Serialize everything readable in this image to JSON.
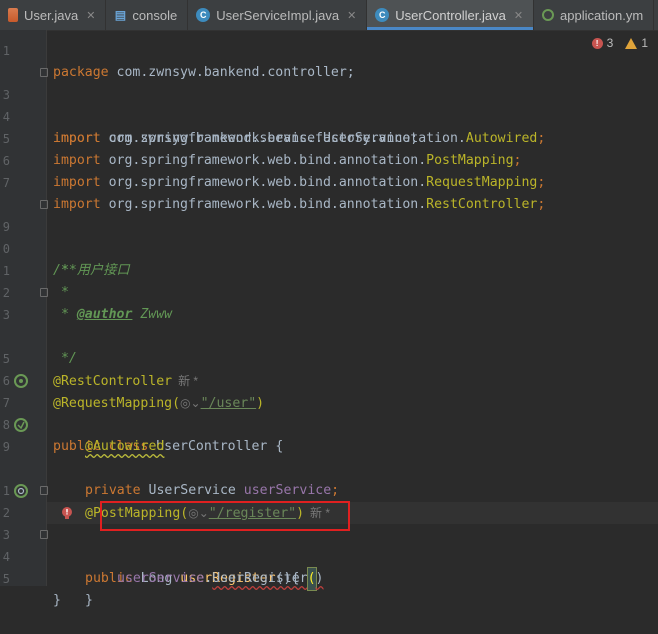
{
  "tabs": [
    {
      "label": "User.java",
      "icon": "java-class-icon",
      "active": false
    },
    {
      "label": "console",
      "icon": "console-icon",
      "active": false
    },
    {
      "label": "UserServiceImpl.java",
      "icon": "java-class-icon",
      "active": false
    },
    {
      "label": "UserController.java",
      "icon": "java-class-icon",
      "active": true
    },
    {
      "label": "application.ym",
      "icon": "spring-config-icon",
      "active": false
    }
  ],
  "inspection": {
    "errors": "3",
    "warnings": "1"
  },
  "gutter_line_numbers": [
    "1",
    "",
    "3",
    "4",
    "5",
    "6",
    "7",
    "",
    "9",
    "0",
    "1",
    "2",
    "3",
    "4",
    "5",
    "6",
    "7",
    "8",
    "9",
    "0",
    "1",
    "2",
    "3",
    "4",
    "5"
  ],
  "code": {
    "l1_kw": "package",
    "l1_rest": " com.zwnsyw.bankend.controller;",
    "imp": "import",
    "l3": " com.zwnsyw.bankend.service.UserService;",
    "l4_pkg": " org.springframework.beans.factory.annotation.",
    "l4_cls": "Autowired",
    "l5_pkg": " org.springframework.web.bind.annotation.",
    "l5_cls": "PostMapping",
    "l6_pkg": " org.springframework.web.bind.annotation.",
    "l6_cls": "RequestMapping",
    "l7_pkg": " org.springframework.web.bind.annotation.",
    "l7_cls": "RestController",
    "semi": ";",
    "doc_open": "/**",
    "doc_line1": " * 用户接口",
    "doc_star": " *",
    "doc_author_prefix": " * ",
    "doc_author_tag": "@author",
    "doc_author_name": " Zwww",
    "doc_close": " */",
    "ann_rest": "@RestController",
    "hint_new": "新 *",
    "ann_reqmap": "@RequestMapping(",
    "reqmap_path": "\"/user\"",
    "close_paren": ")",
    "cls_decl_kw": "public class",
    "cls_decl_name": " UserController {",
    "ann_autowired": "@Autowired",
    "field_kw": "private",
    "field_type": " UserService ",
    "field_name": "userService",
    "ann_postmap": "@PostMapping(",
    "postmap_path": "\"/register\"",
    "method_kw": "public",
    "method_type": " Long ",
    "method_name": "userRegister",
    "method_tail": "(){",
    "call_obj": "userService",
    "call_dot": ".",
    "call_method": "UserRegister",
    "call_paren_open": "(",
    "call_paren_close": ")",
    "close_brace_inner": "}",
    "close_brace_outer": "}"
  }
}
